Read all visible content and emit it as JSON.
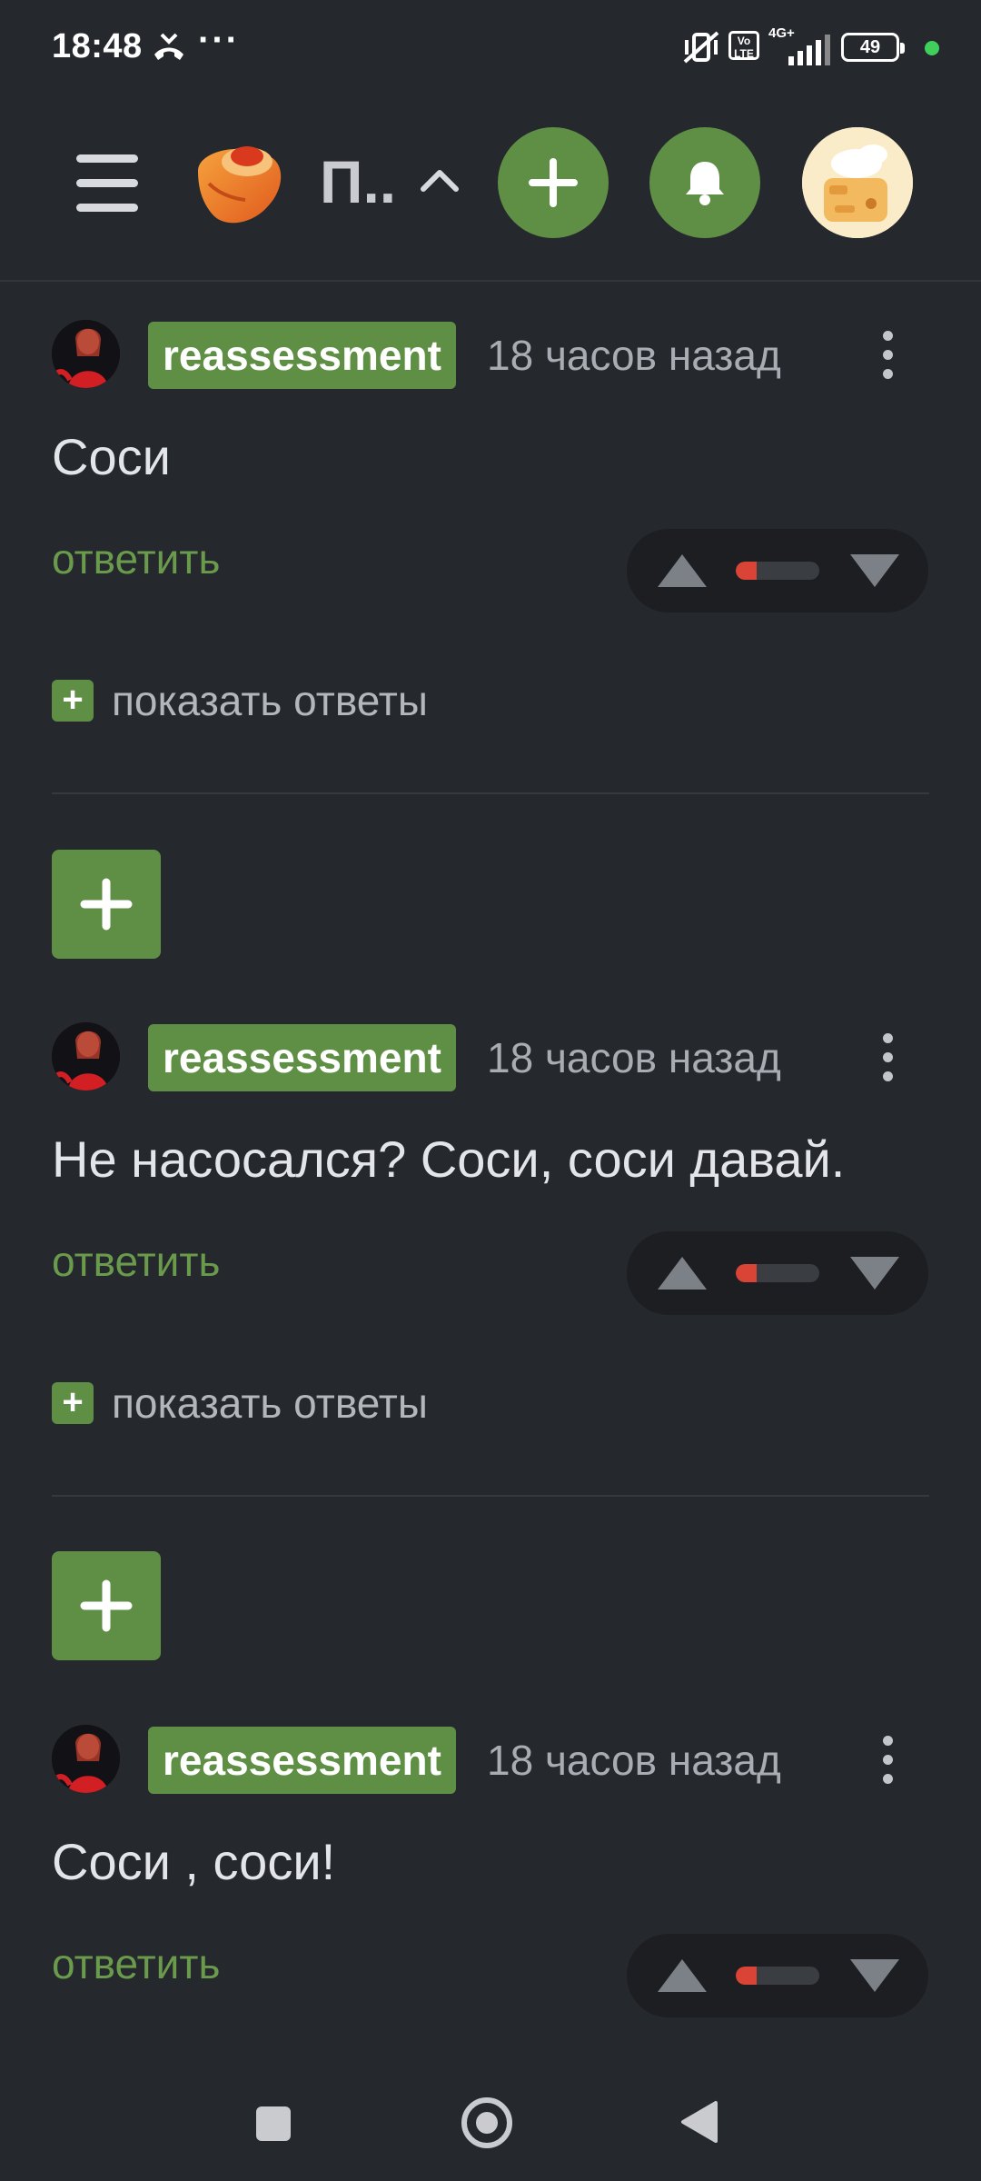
{
  "status_bar": {
    "time": "18:48",
    "dots": "···",
    "volte": "Vo LTE",
    "network": "4G+",
    "battery": "49"
  },
  "header": {
    "title": "П..",
    "icons": [
      "menu-icon",
      "site-logo",
      "chevron-up-icon",
      "plus-icon",
      "bell-icon",
      "user-avatar"
    ]
  },
  "comments": [
    {
      "username": "reassessment",
      "time": "18 часов назад",
      "text": "Соси",
      "reply_label": "ответить",
      "vote_ratio": 0.25,
      "show_replies": "показать ответы"
    },
    {
      "username": "reassessment",
      "time": "18 часов назад",
      "text": "Не насосался? Соси, соси давай.",
      "reply_label": "ответить",
      "vote_ratio": 0.25,
      "show_replies": "показать ответы"
    },
    {
      "username": "reassessment",
      "time": "18 часов назад",
      "text": "Соси , соси!",
      "reply_label": "ответить",
      "vote_ratio": 0.25
    }
  ],
  "colors": {
    "background": "#25282d",
    "accent_green": "#5f8f45",
    "reply_green": "#6a9a4b",
    "downvote_red": "#d94436"
  }
}
